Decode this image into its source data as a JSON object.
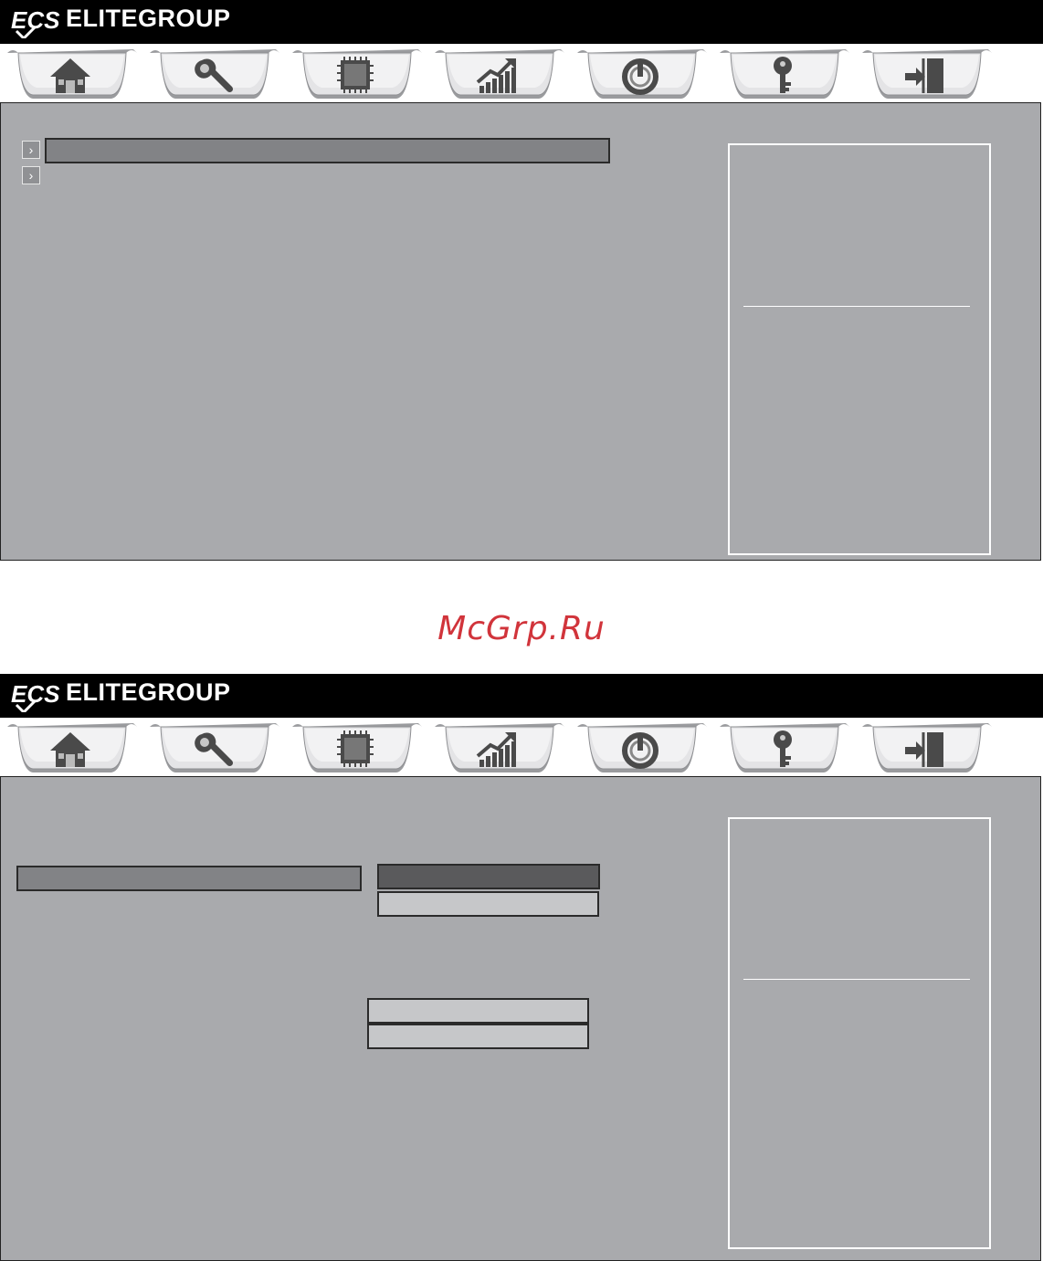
{
  "brand": {
    "name": "ELITEGROUP",
    "logo_text": "ECS"
  },
  "tabs": [
    {
      "name": "main",
      "icon": "home-icon"
    },
    {
      "name": "advanced",
      "icon": "wrench-icon"
    },
    {
      "name": "chipset",
      "icon": "chip-icon"
    },
    {
      "name": "mi",
      "icon": "chart-up-icon"
    },
    {
      "name": "boot",
      "icon": "power-icon"
    },
    {
      "name": "security",
      "icon": "key-icon"
    },
    {
      "name": "exit",
      "icon": "exit-door-icon"
    }
  ],
  "watermark": "McGrp.Ru",
  "colors": {
    "panel": "#a9aaad",
    "topbar": "#000000",
    "watermark": "#d1343b",
    "selected_bar": "#828386",
    "dark_option": "#5a5a5c",
    "light_option": "#c6c7c9"
  }
}
